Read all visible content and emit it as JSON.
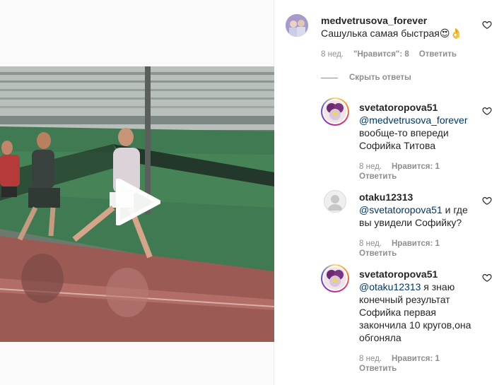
{
  "post": {
    "author": "medvetrusova_forever",
    "caption": "Сашулька самая быстрая😍👌",
    "time": "8 нед.",
    "likes": "\"Нравится\": 8",
    "reply": "Ответить",
    "hide_replies": "Скрыть ответы"
  },
  "replies": [
    {
      "user": "svetatoropova51",
      "mention": "@medvetrusova_forever",
      "line1_rest": "",
      "line2": "вообще-то впереди",
      "line3": "Софийка Титова",
      "time": "8 нед.",
      "likes": "Нравится: 1",
      "reply": "Ответить"
    },
    {
      "user": "otaku12313",
      "mention": "@svetatoropova51",
      "line1_rest": " и где",
      "line2": "вы увидели Софийку?",
      "time": "8 нед.",
      "likes": "Нравится: 1",
      "reply": "Ответить"
    },
    {
      "user": "svetatoropova51",
      "mention": "@otaku12313",
      "line1_rest": " я знаю",
      "line2": "конечный результат",
      "line3": "Софийка первая",
      "line4": "закончила 10 кругов,она",
      "line5": "обгоняла",
      "time": "8 нед.",
      "likes": "Нравится: 1",
      "reply": "Ответить"
    }
  ],
  "icons": {
    "like": "heart-outline-icon",
    "play": "play-icon"
  },
  "colors": {
    "link": "#00376b",
    "secondary": "#8e8e8e",
    "text": "#262626"
  }
}
